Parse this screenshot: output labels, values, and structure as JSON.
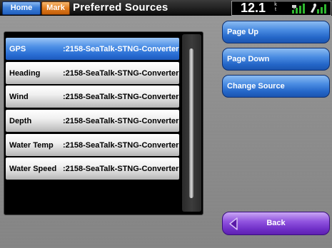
{
  "topbar": {
    "home_label": "Home",
    "mark_label": "Mark",
    "title": "Preferred Sources",
    "speed": "12.1",
    "speed_unit": "k t"
  },
  "sources": [
    {
      "label": "GPS",
      "value": ":2158-SeaTalk-STNG-Converter",
      "selected": true
    },
    {
      "label": "Heading",
      "value": ":2158-SeaTalk-STNG-Converter",
      "selected": false
    },
    {
      "label": "Wind",
      "value": ":2158-SeaTalk-STNG-Converter",
      "selected": false
    },
    {
      "label": "Depth",
      "value": ":2158-SeaTalk-STNG-Converter",
      "selected": false
    },
    {
      "label": "Water Temp",
      "value": ":2158-SeaTalk-STNG-Converter",
      "selected": false
    },
    {
      "label": "Water Speed",
      "value": ":2158-SeaTalk-STNG-Converter",
      "selected": false
    }
  ],
  "actions": {
    "page_up": "Page Up",
    "page_down": "Page Down",
    "change_source": "Change Source",
    "back": "Back"
  },
  "icons": {
    "satellite": "satellite-signal-icon",
    "gps": "gps-signal-icon"
  },
  "colors": {
    "selected_row": "#2a6ed4",
    "side_buttons": "#2466c8",
    "back_button": "#7030c8",
    "mark_button": "#e07c20"
  }
}
